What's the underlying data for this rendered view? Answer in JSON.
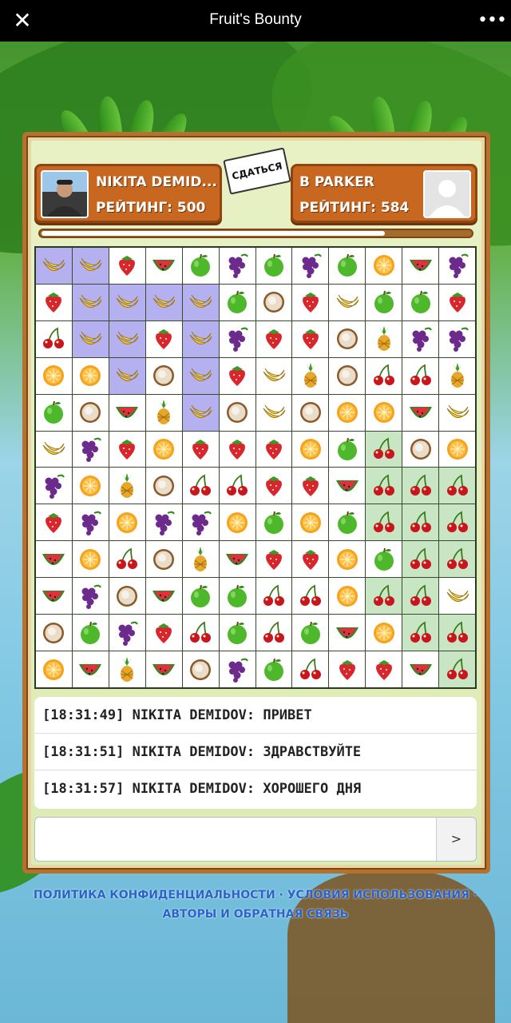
{
  "app": {
    "title": "Fruit's Bounty"
  },
  "topbar": {
    "close_glyph": "✕",
    "more_glyph": "•••"
  },
  "players": {
    "left": {
      "name": "NIKITA DEMID...",
      "rating": "РЕЙТИНГ: 500"
    },
    "right": {
      "name": "B PARKER",
      "rating": "РЕЙТИНГ: 584"
    }
  },
  "surrender_label": "СДАТЬСЯ",
  "timer_progress": 0.8,
  "grid": {
    "rows": [
      [
        "banana",
        "banana",
        "strawberry",
        "watermelon",
        "apple",
        "grape",
        "apple",
        "grape",
        "apple",
        "orange",
        "watermelon",
        "grape"
      ],
      [
        "strawberry",
        "banana",
        "banana",
        "banana",
        "banana",
        "apple",
        "coconut",
        "strawberry",
        "banana",
        "apple",
        "apple",
        "strawberry"
      ],
      [
        "cherry",
        "banana",
        "banana",
        "strawberry",
        "banana",
        "grape",
        "strawberry",
        "strawberry",
        "coconut",
        "pineapple",
        "grape",
        "grape"
      ],
      [
        "orange",
        "orange",
        "banana",
        "coconut",
        "banana",
        "strawberry",
        "banana",
        "pineapple",
        "coconut",
        "cherry",
        "cherry",
        "pineapple"
      ],
      [
        "apple",
        "coconut",
        "watermelon",
        "pineapple",
        "banana",
        "coconut",
        "banana",
        "coconut",
        "orange",
        "orange",
        "watermelon",
        "banana"
      ],
      [
        "banana",
        "grape",
        "strawberry",
        "orange",
        "strawberry",
        "strawberry",
        "strawberry",
        "orange",
        "apple",
        "cherry",
        "coconut",
        "orange"
      ],
      [
        "grape",
        "orange",
        "pineapple",
        "coconut",
        "cherry",
        "cherry",
        "strawberry",
        "strawberry",
        "watermelon",
        "cherry",
        "cherry",
        "cherry"
      ],
      [
        "strawberry",
        "grape",
        "orange",
        "grape",
        "grape",
        "orange",
        "apple",
        "orange",
        "apple",
        "cherry",
        "cherry",
        "cherry"
      ],
      [
        "watermelon",
        "orange",
        "cherry",
        "coconut",
        "pineapple",
        "watermelon",
        "strawberry",
        "strawberry",
        "orange",
        "apple",
        "cherry",
        "cherry"
      ],
      [
        "watermelon",
        "grape",
        "coconut",
        "watermelon",
        "apple",
        "apple",
        "cherry",
        "cherry",
        "orange",
        "cherry",
        "cherry",
        "banana"
      ],
      [
        "coconut",
        "apple",
        "grape",
        "strawberry",
        "cherry",
        "apple",
        "cherry",
        "apple",
        "watermelon",
        "orange",
        "cherry",
        "cherry"
      ],
      [
        "orange",
        "watermelon",
        "pineapple",
        "watermelon",
        "coconut",
        "grape",
        "apple",
        "cherry",
        "strawberry",
        "strawberry",
        "watermelon",
        "cherry"
      ]
    ],
    "selected": [
      [
        0,
        0
      ],
      [
        0,
        1
      ],
      [
        1,
        1
      ],
      [
        1,
        2
      ],
      [
        1,
        3
      ],
      [
        1,
        4
      ],
      [
        2,
        1
      ],
      [
        2,
        2
      ],
      [
        2,
        4
      ],
      [
        3,
        2
      ],
      [
        3,
        4
      ],
      [
        4,
        4
      ]
    ],
    "highlighted": [
      [
        5,
        9
      ],
      [
        6,
        9
      ],
      [
        6,
        10
      ],
      [
        6,
        11
      ],
      [
        7,
        9
      ],
      [
        7,
        10
      ],
      [
        7,
        11
      ],
      [
        8,
        10
      ],
      [
        8,
        11
      ],
      [
        9,
        9
      ],
      [
        9,
        10
      ],
      [
        10,
        10
      ],
      [
        10,
        11
      ],
      [
        11,
        11
      ]
    ]
  },
  "chat": {
    "messages": [
      "[18:31:49] NIKITA DEMIDOV: ПРИВЕТ",
      "[18:31:51] NIKITA DEMIDOV: ЗДРАВСТВУЙТЕ",
      "[18:31:57] NIKITA DEMIDOV: ХОРОШЕГО ДНЯ"
    ],
    "input_value": "",
    "send_label": ">"
  },
  "footer": {
    "privacy": "ПОЛИТИКА КОНФИДЕНЦИАЛЬНОСТИ",
    "terms": "УСЛОВИЯ ИСПОЛЬЗОВАНИЯ",
    "authors": "АВТОРЫ И ОБРАТНАЯ СВЯЗЬ",
    "sep": " · "
  },
  "colors": {
    "banana": "#f3c53b",
    "strawberry": "#d9262c",
    "watermelon": "#e0323c",
    "apple": "#4cb82a",
    "grape": "#6b2a8c",
    "orange": "#f5a21c",
    "coconut": "#e9ddc9",
    "cherry": "#c8151f",
    "pineapple": "#e8a72a"
  }
}
